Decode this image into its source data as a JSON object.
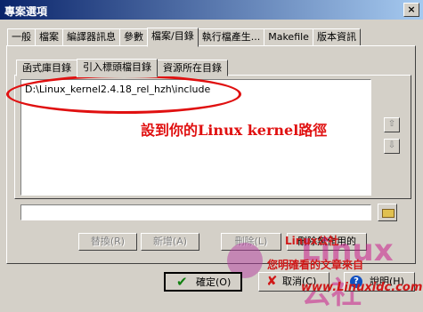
{
  "window": {
    "title": "專案選項",
    "close_glyph": "×"
  },
  "tabs": [
    {
      "label": "一般"
    },
    {
      "label": "檔案"
    },
    {
      "label": "編譯器訊息"
    },
    {
      "label": "參數"
    },
    {
      "label": "檔案/目錄",
      "active": true
    },
    {
      "label": "執行檔產生..."
    },
    {
      "label": "Makefile"
    },
    {
      "label": "版本資訊"
    }
  ],
  "subtabs": [
    {
      "label": "函式庫目錄"
    },
    {
      "label": "引入標頭檔目錄",
      "active": true
    },
    {
      "label": "資源所在目錄"
    }
  ],
  "include_list": {
    "items": [
      "D:\\Linux_kernel2.4.18_rel_hzh\\include"
    ]
  },
  "annotation": {
    "text": "設到你的Linux kernel路徑",
    "color": "#e01010"
  },
  "arrows": {
    "up": "⇧",
    "down": "⇩"
  },
  "path_input": {
    "value": ""
  },
  "buttons": {
    "replace": "替換(R)",
    "add": "新增(A)",
    "delete": "刪除(L)",
    "delete_unused": "刪除無作用的"
  },
  "watermark": {
    "line1": "Linux公社",
    "line2": "您明確看的文章來自",
    "line3": "www.Linuxidc.com",
    "big": "Linux公社"
  },
  "bottom": {
    "ok": "確定(O)",
    "cancel": "取消(C)",
    "help": "說明(H)",
    "help_glyph": "?"
  },
  "colors": {
    "accent_red": "#e01010",
    "title_blue": "#0a246a"
  }
}
